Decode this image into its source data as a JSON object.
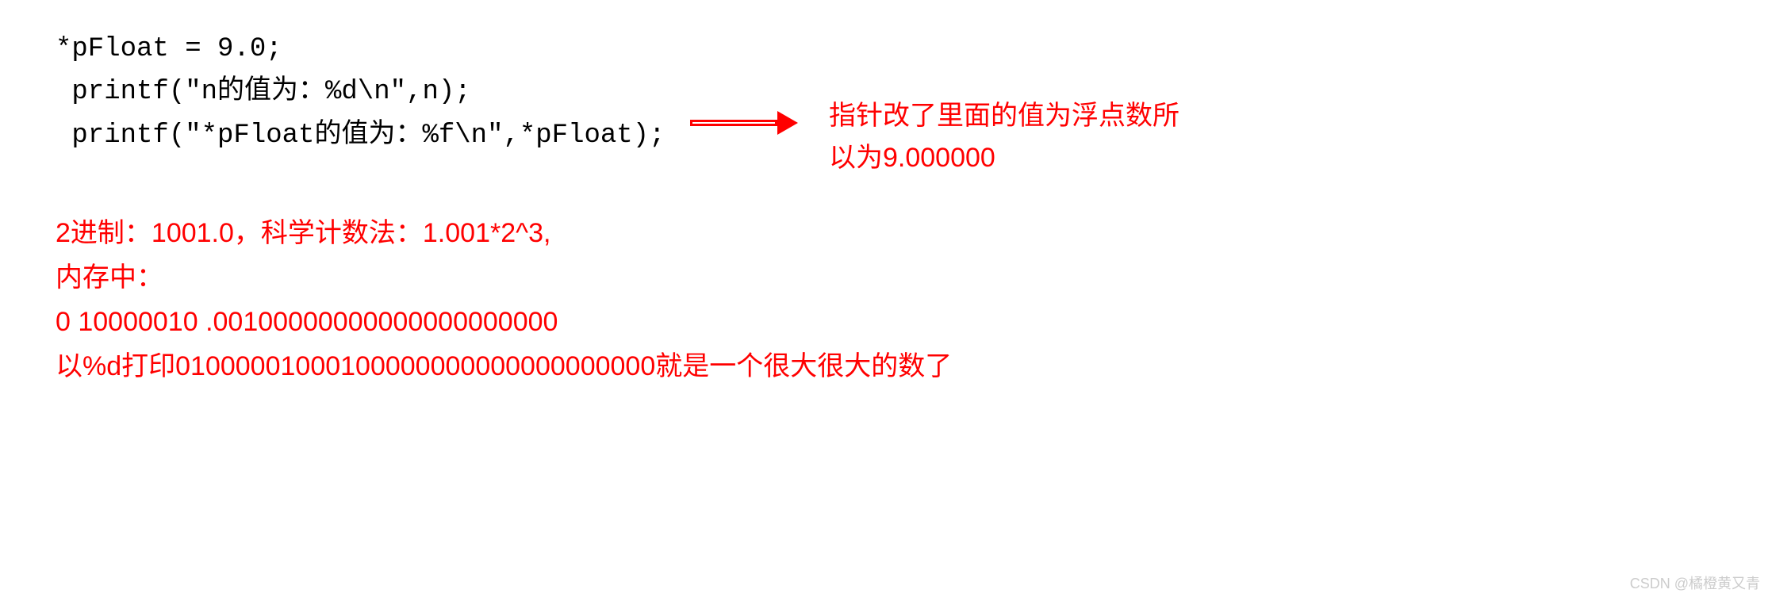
{
  "code": {
    "line1": "*pFloat = 9.0;",
    "line2": " printf(\"n的值为：%d\\n\",n);",
    "line3": " printf(\"*pFloat的值为：%f\\n\",*pFloat);"
  },
  "annotation": {
    "line1": "指针改了里面的值为浮点数所",
    "line2": "以为9.000000"
  },
  "explanation": {
    "line1": "2进制：1001.0，科学计数法：1.001*2^3,",
    "line2": "内存中：",
    "line3": "0 10000010 .00100000000000000000000",
    "line4": "以%d打印01000001000100000000000000000000就是一个很大很大的数了"
  },
  "watermark": "CSDN @橘橙黄又青"
}
